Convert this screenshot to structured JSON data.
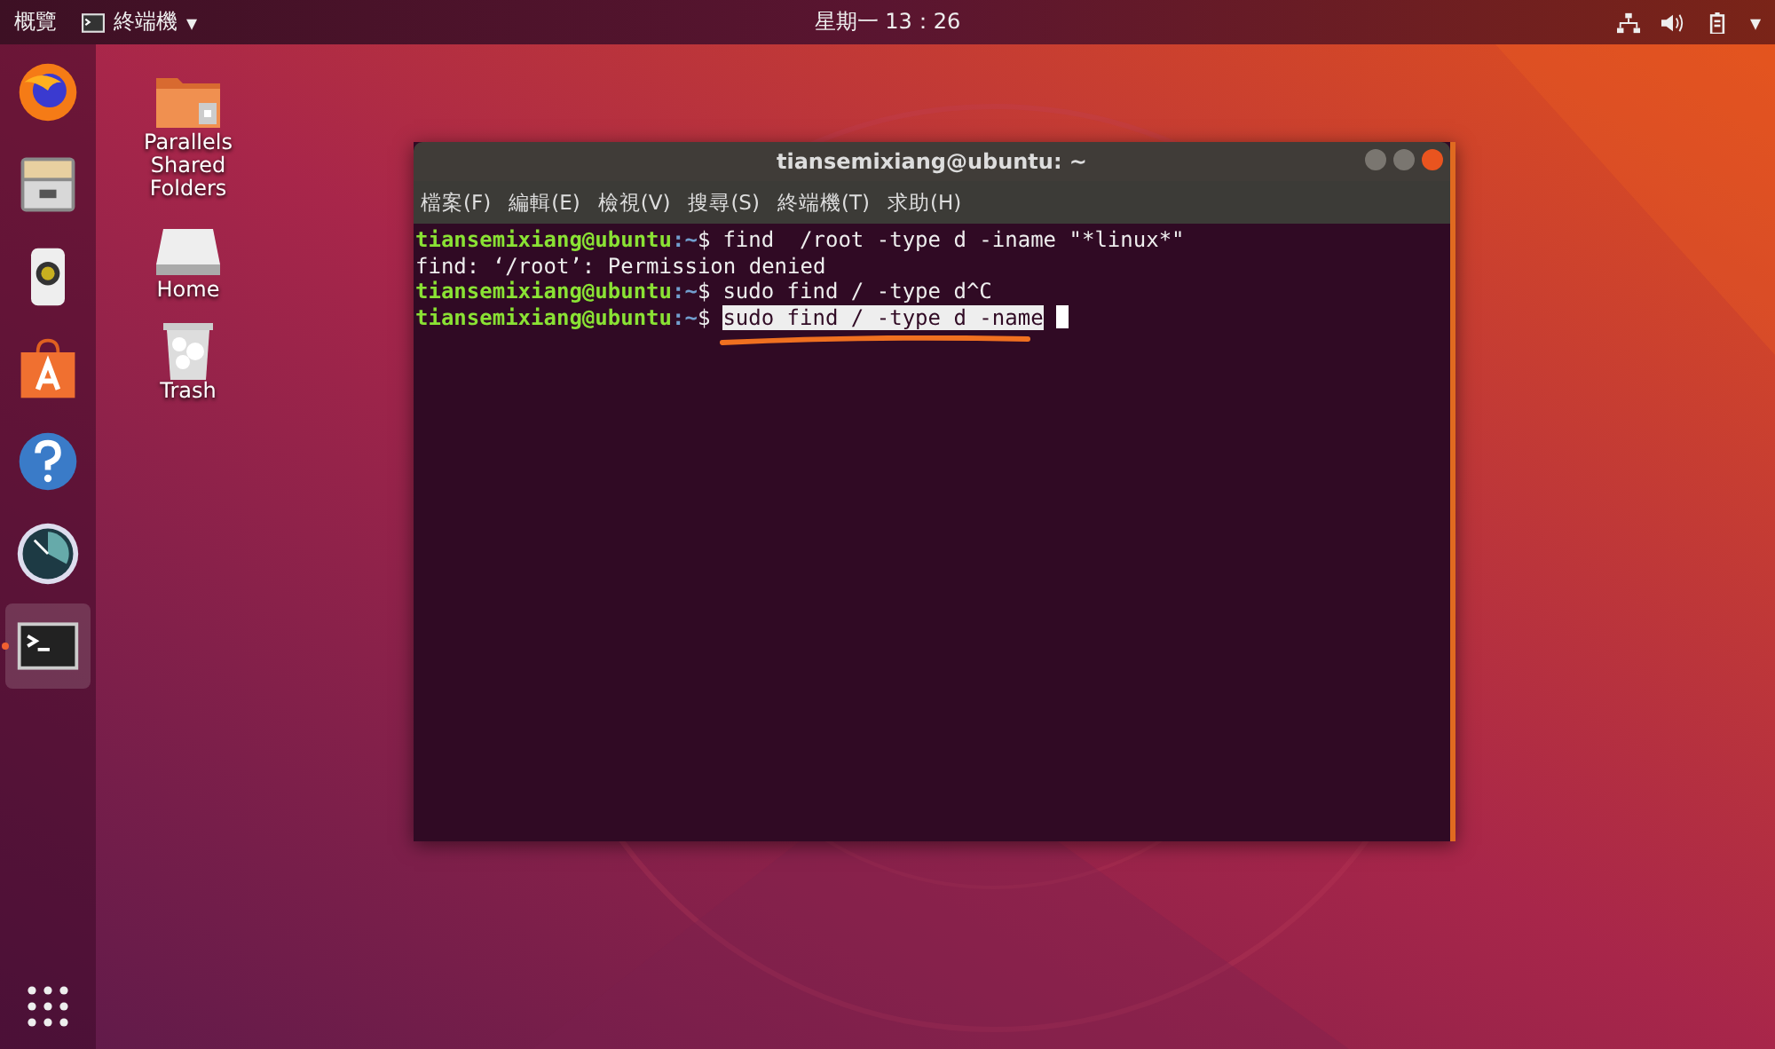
{
  "top_bar": {
    "activities": "概覽",
    "app_menu": "終端機",
    "app_menu_caret": "▾",
    "clock": "星期一 13：26",
    "system_menu_caret": "▾"
  },
  "dock": {
    "items": [
      {
        "kind": "firefox",
        "running": false,
        "selected": false
      },
      {
        "kind": "files",
        "running": false,
        "selected": false
      },
      {
        "kind": "speaker",
        "running": false,
        "selected": false
      },
      {
        "kind": "store",
        "running": false,
        "selected": false
      },
      {
        "kind": "help",
        "running": false,
        "selected": false
      },
      {
        "kind": "gauge",
        "running": false,
        "selected": false
      },
      {
        "kind": "terminal",
        "running": true,
        "selected": true
      }
    ]
  },
  "desktop_icons": [
    {
      "kind": "shared-folder",
      "label": "Parallels Shared Folders"
    },
    {
      "kind": "drive",
      "label": "Home"
    },
    {
      "kind": "trash",
      "label": "Trash"
    }
  ],
  "terminal": {
    "title": "tiansemixiang@ubuntu: ~",
    "menu": [
      "檔案(F)",
      "編輯(E)",
      "檢視(V)",
      "搜尋(S)",
      "終端機(T)",
      "求助(H)"
    ],
    "lines": [
      {
        "kind": "prompt",
        "user": "tiansemixiang@ubuntu",
        "path": ":~",
        "symbol": "$",
        "command": "find  /root -type d -iname \"*linux*\"",
        "selected": false
      },
      {
        "kind": "output",
        "text": "find: ‘/root’: Permission denied"
      },
      {
        "kind": "prompt",
        "user": "tiansemixiang@ubuntu",
        "path": ":~",
        "symbol": "$",
        "command": "sudo find / -type d^C",
        "selected": false
      },
      {
        "kind": "prompt",
        "user": "tiansemixiang@ubuntu",
        "path": ":~",
        "symbol": "$",
        "command": "sudo find / -type d -name",
        "selected": true,
        "cursor": true
      }
    ]
  }
}
